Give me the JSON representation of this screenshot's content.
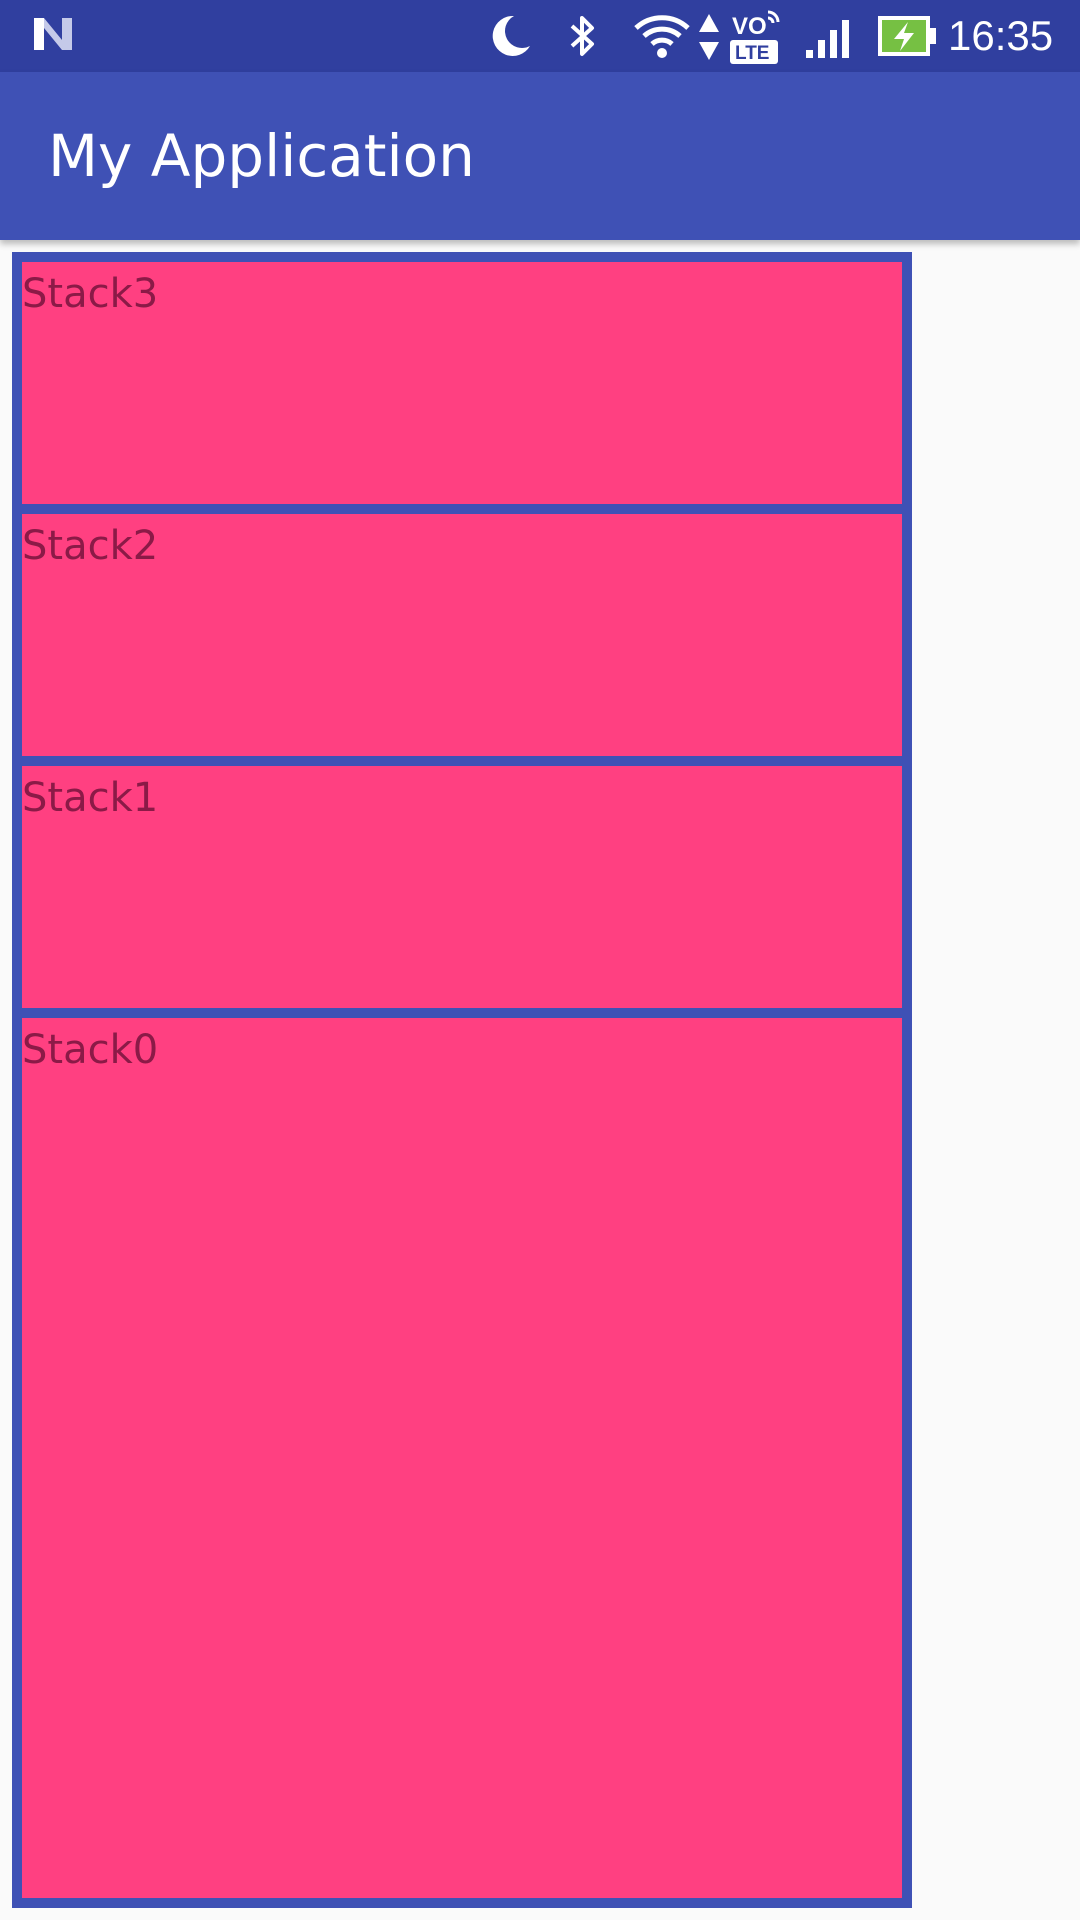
{
  "status_bar": {
    "time": "16:35",
    "icons": [
      "n-logo-icon",
      "moon-icon",
      "bluetooth-icon",
      "wifi-icon",
      "data-arrows-icon",
      "volte-icon",
      "signal-icon",
      "battery-charging-icon"
    ],
    "volte_top": "VO",
    "volte_bottom": "LTE",
    "background": "#303F9F"
  },
  "app_bar": {
    "title": "My Application",
    "background": "#3F51B5"
  },
  "stacks": [
    {
      "label": "Stack3"
    },
    {
      "label": "Stack2"
    },
    {
      "label": "Stack1"
    },
    {
      "label": "Stack0"
    }
  ],
  "colors": {
    "stack_fill": "#FF4081",
    "container_border": "#3F51B5",
    "label_text": "#8B1A47",
    "page_background": "#FAFAFA"
  }
}
